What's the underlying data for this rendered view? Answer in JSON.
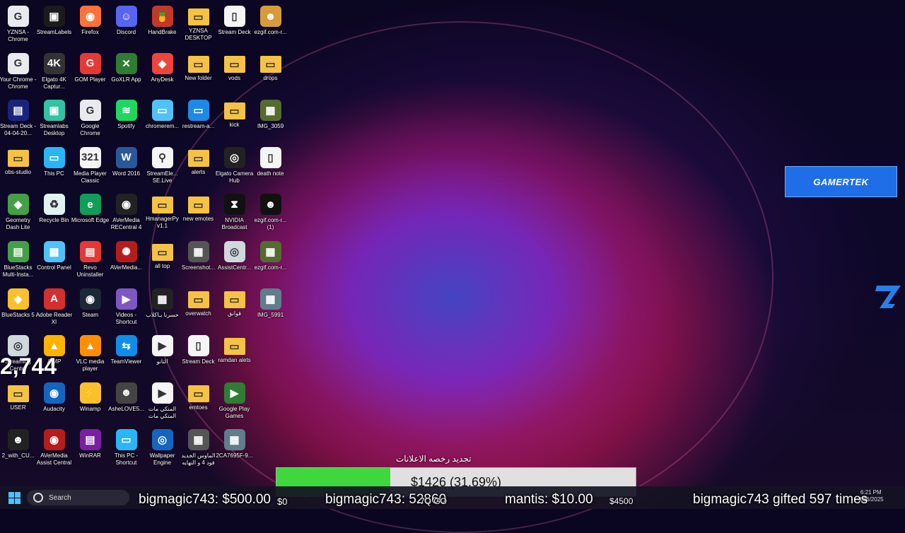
{
  "desktop_icons": [
    {
      "label": "YZNSA - Chrome",
      "color": "#e8eaed",
      "glyph": "G"
    },
    {
      "label": "StreamLabels",
      "color": "#1b1b1b",
      "glyph": "▣"
    },
    {
      "label": "Firefox",
      "color": "#ff7139",
      "glyph": "◉"
    },
    {
      "label": "Discord",
      "color": "#5865f2",
      "glyph": "☺"
    },
    {
      "label": "HandBrake",
      "color": "#c0392b",
      "glyph": "🍍"
    },
    {
      "label": "YZNSA DESKTOP",
      "color": "#f6c244",
      "glyph": "▭"
    },
    {
      "label": "Stream Deck",
      "color": "#f5f5f5",
      "glyph": "▯"
    },
    {
      "label": "ezgif.com-r...",
      "color": "#d79b3a",
      "glyph": "☻"
    },
    {
      "label": "Your Chrome - Chrome",
      "color": "#e8eaed",
      "glyph": "G"
    },
    {
      "label": "Elgato 4K Captur...",
      "color": "#333",
      "glyph": "4K"
    },
    {
      "label": "GOM Player",
      "color": "#e53935",
      "glyph": "G"
    },
    {
      "label": "GoXLR App",
      "color": "#2e7d32",
      "glyph": "✕"
    },
    {
      "label": "AnyDesk",
      "color": "#ef443b",
      "glyph": "◆"
    },
    {
      "label": "New folder",
      "color": "#f6c244",
      "glyph": "▭"
    },
    {
      "label": "vods",
      "color": "#f6c244",
      "glyph": "▭"
    },
    {
      "label": "drops",
      "color": "#f6c244",
      "glyph": "▭"
    },
    {
      "label": "Stream Deck - 04-04-20...",
      "color": "#1a237e",
      "glyph": "▤"
    },
    {
      "label": "Streamlabs Desktop",
      "color": "#31c3a2",
      "glyph": "▣"
    },
    {
      "label": "Google Chrome",
      "color": "#e8eaed",
      "glyph": "G"
    },
    {
      "label": "Spotify",
      "color": "#1ed760",
      "glyph": "≋"
    },
    {
      "label": "chromerem...",
      "color": "#4fc3f7",
      "glyph": "▭"
    },
    {
      "label": "restream-a...",
      "color": "#1e88e5",
      "glyph": "▭"
    },
    {
      "label": "kick",
      "color": "#f6c244",
      "glyph": "▭"
    },
    {
      "label": "IMG_3059",
      "color": "#556b2f",
      "glyph": "▦"
    },
    {
      "label": "obs-studio",
      "color": "#f6c244",
      "glyph": "▭"
    },
    {
      "label": "This PC",
      "color": "#29b6f6",
      "glyph": "▭"
    },
    {
      "label": "Media Player Classic",
      "color": "#f5f5f5",
      "glyph": "321"
    },
    {
      "label": "Word 2016",
      "color": "#2b579a",
      "glyph": "W"
    },
    {
      "label": "StreamEle... SE.Live",
      "color": "#f5f5f5",
      "glyph": "⚲"
    },
    {
      "label": "alerts",
      "color": "#f6c244",
      "glyph": "▭"
    },
    {
      "label": "Elgato Camera Hub",
      "color": "#222",
      "glyph": "◎"
    },
    {
      "label": "death note",
      "color": "#f5f5f5",
      "glyph": "▯"
    },
    {
      "label": "Geometry Dash Lite",
      "color": "#43a047",
      "glyph": "◆"
    },
    {
      "label": "Recycle Bin",
      "color": "#e0f2f1",
      "glyph": "♻"
    },
    {
      "label": "Microsoft Edge",
      "color": "#0f9d58",
      "glyph": "e"
    },
    {
      "label": "AVerMedia RECentral 4",
      "color": "#222",
      "glyph": "◉"
    },
    {
      "label": "HmanagerPy v1.1",
      "color": "#f6c244",
      "glyph": "▭"
    },
    {
      "label": "new emotes",
      "color": "#f6c244",
      "glyph": "▭"
    },
    {
      "label": "NVIDIA Broadcast",
      "color": "#111",
      "glyph": "⧗"
    },
    {
      "label": "ezgif.com-r... (1)",
      "color": "#111",
      "glyph": "☻"
    },
    {
      "label": "BlueStacks Multi-Insta...",
      "color": "#43a047",
      "glyph": "▤"
    },
    {
      "label": "Control Panel",
      "color": "#4fc3f7",
      "glyph": "▦"
    },
    {
      "label": "Revo Uninstaller",
      "color": "#e53935",
      "glyph": "▤"
    },
    {
      "label": "AVerMedia...",
      "color": "#b71c1c",
      "glyph": "✺"
    },
    {
      "label": "all top",
      "color": "#f6c244",
      "glyph": "▭"
    },
    {
      "label": "Screenshot...",
      "color": "#555",
      "glyph": "▦"
    },
    {
      "label": "AssistCentr...",
      "color": "#cfd8dc",
      "glyph": "◎"
    },
    {
      "label": "ezgif.com-r...",
      "color": "#556b2f",
      "glyph": "▦"
    },
    {
      "label": "BlueStacks 5",
      "color": "#fbc02d",
      "glyph": "◆"
    },
    {
      "label": "Adobe Reader XI",
      "color": "#d32f2f",
      "glyph": "A"
    },
    {
      "label": "Steam",
      "color": "#1b2838",
      "glyph": "◉"
    },
    {
      "label": "Videos - Shortcut",
      "color": "#7e57c2",
      "glyph": "▶"
    },
    {
      "label": "خسرنا يـاكلاب",
      "color": "#222",
      "glyph": "▦"
    },
    {
      "label": "overwatch",
      "color": "#f6c244",
      "glyph": "▭"
    },
    {
      "label": "قوانق",
      "color": "#f6c244",
      "glyph": "▭"
    },
    {
      "label": "IMG_5991",
      "color": "#607d8b",
      "glyph": "▦"
    },
    {
      "label": "Streaming Center",
      "color": "#cfd8dc",
      "glyph": "◎"
    },
    {
      "label": "AIMP",
      "color": "#ffb300",
      "glyph": "▲"
    },
    {
      "label": "VLC media player",
      "color": "#ff8f00",
      "glyph": "▲"
    },
    {
      "label": "TeamViewer",
      "color": "#0e8ee9",
      "glyph": "⇆"
    },
    {
      "label": "التانو",
      "color": "#f5f5f5",
      "glyph": "▶"
    },
    {
      "label": "Stream Deck",
      "color": "#f5f5f5",
      "glyph": "▯"
    },
    {
      "label": "ramdan alets",
      "color": "#f6c244",
      "glyph": "▭"
    },
    {
      "label": "",
      "color": "transparent",
      "glyph": ""
    },
    {
      "label": "USER",
      "color": "#f6c244",
      "glyph": "▭"
    },
    {
      "label": "Audacity",
      "color": "#1565c0",
      "glyph": "◉"
    },
    {
      "label": "Winamp",
      "color": "#fbc02d",
      "glyph": "⚡"
    },
    {
      "label": "AsheLOVE5...",
      "color": "#444",
      "glyph": "☻"
    },
    {
      "label": "المتكي مات المتكي مات",
      "color": "#f5f5f5",
      "glyph": "▶"
    },
    {
      "label": "emtoes",
      "color": "#f6c244",
      "glyph": "▭"
    },
    {
      "label": "Google Play Games",
      "color": "#2e7d32",
      "glyph": "▶"
    },
    {
      "label": "",
      "color": "transparent",
      "glyph": ""
    },
    {
      "label": "2_with_CU...",
      "color": "#222",
      "glyph": "☻"
    },
    {
      "label": "AVerMedia Assist Central",
      "color": "#b71c1c",
      "glyph": "◉"
    },
    {
      "label": "WinRAR",
      "color": "#7b1fa2",
      "glyph": "▤"
    },
    {
      "label": "This PC - Shortcut",
      "color": "#29b6f6",
      "glyph": "▭"
    },
    {
      "label": "Wallpaper Engine",
      "color": "#1565c0",
      "glyph": "◎"
    },
    {
      "label": "الماوس الجديد فود 4 و النهايه",
      "color": "#555",
      "glyph": "▦"
    },
    {
      "label": "2CA7695F-9...",
      "color": "#607d8b",
      "glyph": "▦"
    },
    {
      "label": "",
      "color": "transparent",
      "glyph": ""
    }
  ],
  "overlay": {
    "brand_label": "GAMERTEK",
    "counter": "2,744",
    "goal_title": "تجديد رخصه الاعلانات",
    "goal_text": "$1426 (31.69%)",
    "goal_fraction": 0.3169,
    "goal_color": "#3ed73e"
  },
  "taskbar": {
    "search_placeholder": "Search",
    "time": "6:21 PM",
    "date": "3/26/2025"
  },
  "ticker": [
    {
      "text": "bigmagic743: $500.00"
    },
    {
      "text": "$0"
    },
    {
      "text": "bigmagic743: 52860"
    },
    {
      "text": "7Q GO"
    },
    {
      "text": "mantis: $10.00"
    },
    {
      "text": "$4500"
    },
    {
      "text": "bigmagic743 gifted 597 times"
    }
  ]
}
